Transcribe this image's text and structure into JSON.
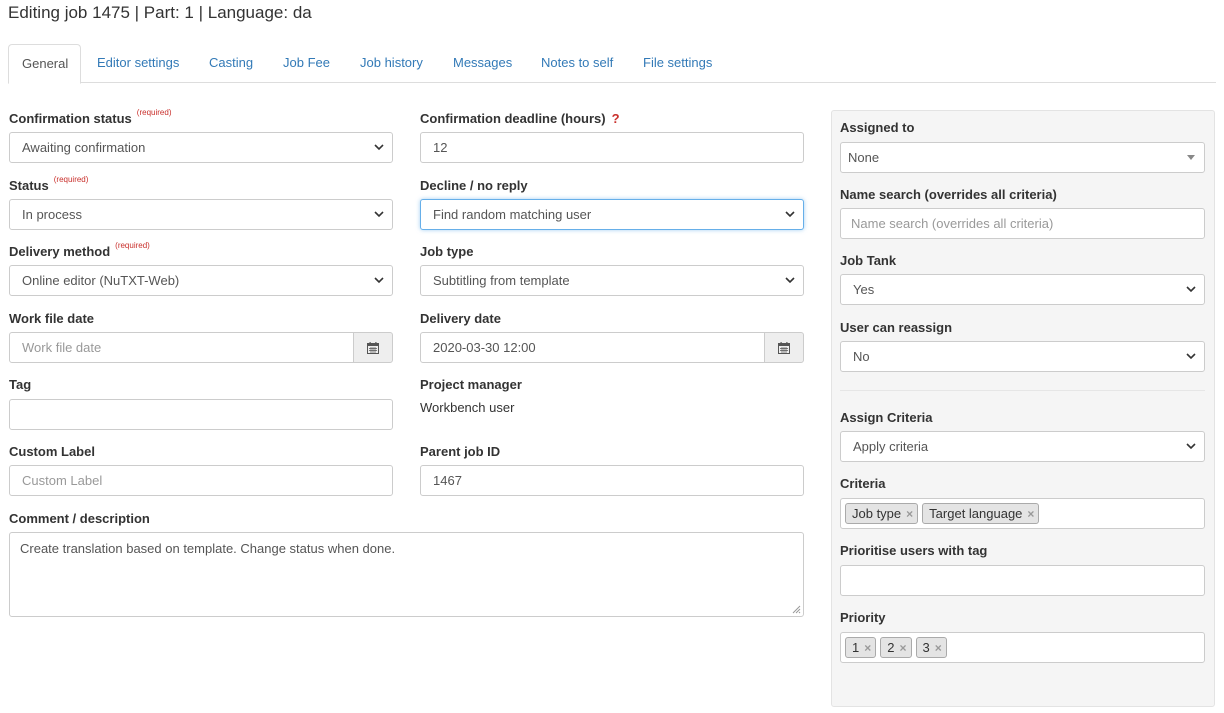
{
  "page": {
    "title": "Editing job 1475 | Part: 1 | Language: da"
  },
  "tabs": [
    {
      "label": "General",
      "active": true
    },
    {
      "label": "Editor settings"
    },
    {
      "label": "Casting"
    },
    {
      "label": "Job Fee"
    },
    {
      "label": "Job history"
    },
    {
      "label": "Messages"
    },
    {
      "label": "Notes to self"
    },
    {
      "label": "File settings"
    }
  ],
  "required_text": "(required)",
  "help_mark": "?",
  "form": {
    "confirmation_status": {
      "label": "Confirmation status",
      "value": "Awaiting confirmation"
    },
    "confirmation_deadline": {
      "label": "Confirmation deadline (hours)",
      "value": "12"
    },
    "status": {
      "label": "Status",
      "value": "In process"
    },
    "decline": {
      "label": "Decline / no reply",
      "value": "Find random matching user"
    },
    "delivery_method": {
      "label": "Delivery method",
      "value": "Online editor (NuTXT-Web)"
    },
    "job_type": {
      "label": "Job type",
      "value": "Subtitling from template"
    },
    "work_file_date": {
      "label": "Work file date",
      "placeholder": "Work file date",
      "value": ""
    },
    "delivery_date": {
      "label": "Delivery date",
      "value": "2020-03-30 12:00"
    },
    "tag": {
      "label": "Tag",
      "value": ""
    },
    "project_manager": {
      "label": "Project manager",
      "value": "Workbench user"
    },
    "custom_label": {
      "label": "Custom Label",
      "placeholder": "Custom Label",
      "value": ""
    },
    "parent_job_id": {
      "label": "Parent job ID",
      "value": "1467"
    },
    "comment": {
      "label": "Comment / description",
      "value": "Create translation based on template. Change status when done."
    }
  },
  "sidebar": {
    "assigned_to": {
      "label": "Assigned to",
      "value": "None"
    },
    "name_search": {
      "label": "Name search (overrides all criteria)",
      "placeholder": "Name search (overrides all criteria)"
    },
    "job_tank": {
      "label": "Job Tank",
      "value": "Yes"
    },
    "user_can_reassign": {
      "label": "User can reassign",
      "value": "No"
    },
    "assign_criteria": {
      "label": "Assign Criteria",
      "value": "Apply criteria"
    },
    "criteria": {
      "label": "Criteria",
      "tags": [
        "Job type",
        "Target language"
      ]
    },
    "prioritise_tag": {
      "label": "Prioritise users with tag",
      "value": ""
    },
    "priority": {
      "label": "Priority",
      "tags": [
        "1",
        "2",
        "3"
      ]
    }
  },
  "icons": {
    "calendar": "calendar-icon",
    "remove": "×"
  },
  "colors": {
    "link": "#337ab7",
    "required": "#c9302c",
    "focus_border": "#66afe9",
    "panel_bg": "#f5f5f5"
  }
}
